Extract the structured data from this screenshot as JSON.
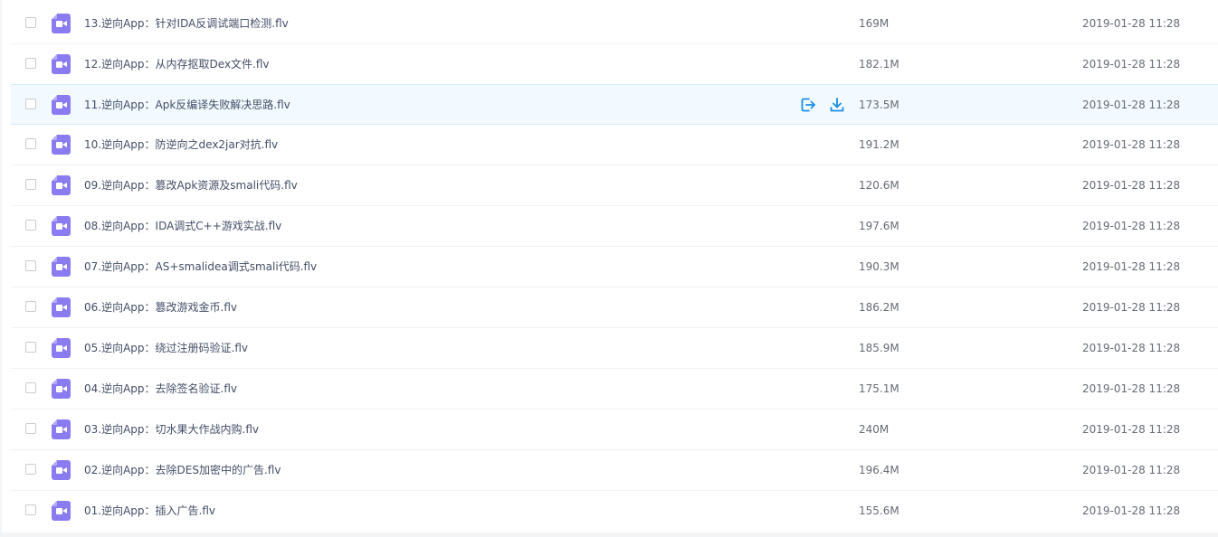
{
  "accent_color": "#1a8ee8",
  "file_icon_color": "#8a7cf0",
  "files": [
    {
      "name": "13.逆向App：针对IDA反调试端口检测.flv",
      "size": "169M",
      "date": "2019-01-28 11:28"
    },
    {
      "name": "12.逆向App：从内存抠取Dex文件.flv",
      "size": "182.1M",
      "date": "2019-01-28 11:28"
    },
    {
      "name": "11.逆向App：Apk反编译失败解决思路.flv",
      "size": "173.5M",
      "date": "2019-01-28 11:28"
    },
    {
      "name": "10.逆向App：防逆向之dex2jar对抗.flv",
      "size": "191.2M",
      "date": "2019-01-28 11:28"
    },
    {
      "name": "09.逆向App：篡改Apk资源及smali代码.flv",
      "size": "120.6M",
      "date": "2019-01-28 11:28"
    },
    {
      "name": "08.逆向App：IDA调式C++游戏实战.flv",
      "size": "197.6M",
      "date": "2019-01-28 11:28"
    },
    {
      "name": "07.逆向App：AS+smalidea调式smali代码.flv",
      "size": "190.3M",
      "date": "2019-01-28 11:28"
    },
    {
      "name": "06.逆向App：篡改游戏金币.flv",
      "size": "186.2M",
      "date": "2019-01-28 11:28"
    },
    {
      "name": "05.逆向App：绕过注册码验证.flv",
      "size": "185.9M",
      "date": "2019-01-28 11:28"
    },
    {
      "name": "04.逆向App：去除签名验证.flv",
      "size": "175.1M",
      "date": "2019-01-28 11:28"
    },
    {
      "name": "03.逆向App：切水果大作战内购.flv",
      "size": "240M",
      "date": "2019-01-28 11:28"
    },
    {
      "name": "02.逆向App：去除DES加密中的广告.flv",
      "size": "196.4M",
      "date": "2019-01-28 11:28"
    },
    {
      "name": "01.逆向App：插入广告.flv",
      "size": "155.6M",
      "date": "2019-01-28 11:28"
    }
  ],
  "hover_row_actions": [
    "share-icon",
    "download-icon"
  ]
}
